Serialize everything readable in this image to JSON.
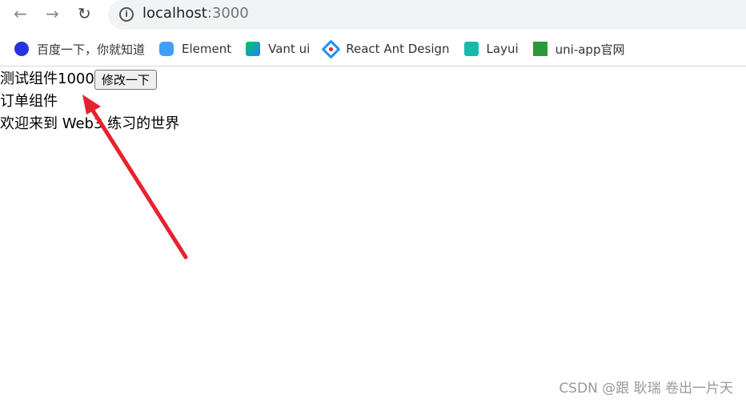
{
  "browser": {
    "url_host": "localhost",
    "url_port": ":3000",
    "bookmarks": [
      {
        "label": "百度一下，你就知道",
        "icon": "baidu-icon",
        "color": "#2932e1"
      },
      {
        "label": "Element",
        "icon": "element-icon",
        "color": "#409eff"
      },
      {
        "label": "Vant ui",
        "icon": "vant-icon",
        "color": "#07c160"
      },
      {
        "label": "React Ant Design",
        "icon": "antd-icon",
        "color": "#1890ff"
      },
      {
        "label": "Layui",
        "icon": "layui-icon",
        "color": "#16baaa"
      },
      {
        "label": "uni-app官网",
        "icon": "uniapp-icon",
        "color": "#2b9939"
      }
    ]
  },
  "page": {
    "test_component": "测试组件1000",
    "modify_button": "修改一下",
    "order_component": "订单组件",
    "welcome": "欢迎来到 Web3 练习的世界"
  },
  "annotation": {
    "arrow_color": "#e8212e"
  },
  "watermark": "CSDN @跟 耿瑞 卷出一片天"
}
